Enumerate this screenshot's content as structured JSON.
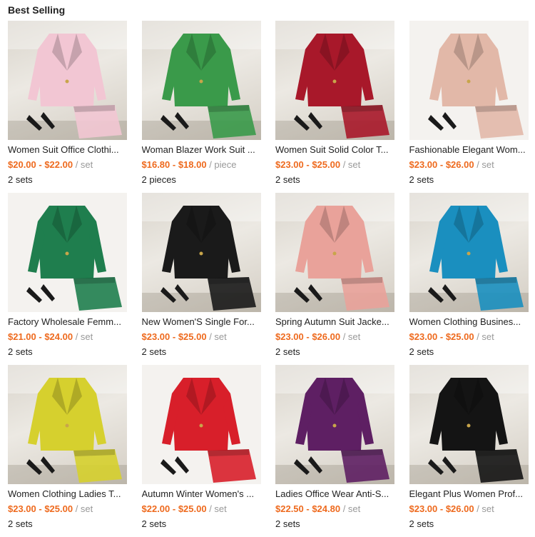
{
  "section": {
    "title": "Best Selling"
  },
  "colors": {
    "price": "#ee6a1e",
    "unit": "#999999",
    "text": "#222222"
  },
  "products": [
    {
      "name": "Women Suit Office Clothi...",
      "price": "$20.00 - $22.00",
      "unit": "/ set",
      "moq": "2 sets",
      "color": "#f2c6d3",
      "scene": "sofa"
    },
    {
      "name": "Woman Blazer Work Suit ...",
      "price": "$16.80 - $18.00",
      "unit": "/ piece",
      "moq": "2 pieces",
      "color": "#3a9a4a",
      "scene": "sofa"
    },
    {
      "name": "Women Suit Solid Color T...",
      "price": "$23.00 - $25.00",
      "unit": "/ set",
      "moq": "2 sets",
      "color": "#a8182a",
      "scene": "sofa"
    },
    {
      "name": "Fashionable Elegant Wom...",
      "price": "$23.00 - $26.00",
      "unit": "/ set",
      "moq": "2 sets",
      "color": "#e2b8a8",
      "scene": "light"
    },
    {
      "name": "Factory Wholesale Femm...",
      "price": "$21.00 - $24.00",
      "unit": "/ set",
      "moq": "2 sets",
      "color": "#1f7e4e",
      "scene": "light"
    },
    {
      "name": "New Women'S Single For...",
      "price": "$23.00 - $25.00",
      "unit": "/ set",
      "moq": "2 sets",
      "color": "#1a1a1a",
      "scene": "sofa"
    },
    {
      "name": "Spring Autumn Suit Jacke...",
      "price": "$23.00 - $26.00",
      "unit": "/ set",
      "moq": "2 sets",
      "color": "#e9a29a",
      "scene": "sofa"
    },
    {
      "name": "Women Clothing Busines...",
      "price": "$23.00 - $25.00",
      "unit": "/ set",
      "moq": "2 sets",
      "color": "#1a8fbf",
      "scene": "sofa"
    },
    {
      "name": "Women Clothing Ladies T...",
      "price": "$23.00 - $25.00",
      "unit": "/ set",
      "moq": "2 sets",
      "color": "#d6d02e",
      "scene": "sofa"
    },
    {
      "name": "Autumn Winter Women's ...",
      "price": "$22.00 - $25.00",
      "unit": "/ set",
      "moq": "2 sets",
      "color": "#d81f2a",
      "scene": "light"
    },
    {
      "name": "Ladies Office Wear Anti-S...",
      "price": "$22.50 - $24.80",
      "unit": "/ set",
      "moq": "2 sets",
      "color": "#5e1f63",
      "scene": "sofa"
    },
    {
      "name": "Elegant Plus Women Prof...",
      "price": "$23.00 - $26.00",
      "unit": "/ set",
      "moq": "2 sets",
      "color": "#141414",
      "scene": "sofa"
    }
  ]
}
